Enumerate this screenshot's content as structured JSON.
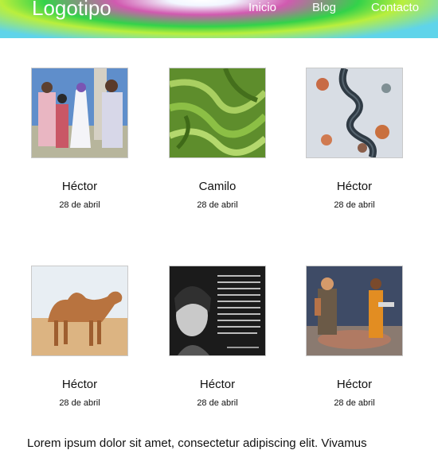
{
  "header": {
    "logo": "Logotipo",
    "nav": [
      "Inicio",
      "Blog",
      "Contacto"
    ]
  },
  "cards": [
    {
      "name": "Héctor",
      "date": "28 de abril",
      "image": "anime-knights-image"
    },
    {
      "name": "Camilo",
      "date": "28 de abril",
      "image": "green-terraces-image"
    },
    {
      "name": "Héctor",
      "date": "28 de abril",
      "image": "winding-road-image"
    },
    {
      "name": "Héctor",
      "date": "28 de abril",
      "image": "camel-desert-image"
    },
    {
      "name": "Héctor",
      "date": "28 de abril",
      "image": "quote-portrait-image"
    },
    {
      "name": "Héctor",
      "date": "28 de abril",
      "image": "game-characters-image"
    }
  ],
  "body_text": "Lorem ipsum dolor sit amet, consectetur adipiscing elit. Vivamus"
}
